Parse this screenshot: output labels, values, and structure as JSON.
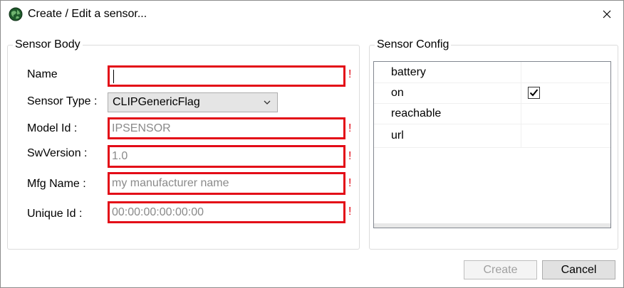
{
  "window": {
    "title": "Create / Edit a sensor..."
  },
  "sensor_body": {
    "legend": "Sensor Body",
    "fields": {
      "name": {
        "label": "Name",
        "value": "",
        "placeholder": ""
      },
      "sensor_type": {
        "label": "Sensor Type :",
        "selected": "CLIPGenericFlag"
      },
      "model_id": {
        "label": "Model Id :",
        "placeholder": "IPSENSOR"
      },
      "sw_version": {
        "label": "SwVersion :",
        "placeholder": "1.0"
      },
      "mfg_name": {
        "label": "Mfg Name :",
        "placeholder": "my manufacturer name"
      },
      "unique_id": {
        "label": "Unique Id :",
        "placeholder": "00:00:00:00:00:00"
      }
    },
    "required_marker": "!"
  },
  "sensor_config": {
    "legend": "Sensor Config",
    "rows": [
      {
        "name": "battery",
        "checked": false
      },
      {
        "name": "on",
        "checked": true
      },
      {
        "name": "reachable",
        "checked": false
      },
      {
        "name": "url",
        "checked": false
      }
    ]
  },
  "buttons": {
    "create_label": "Create",
    "cancel_label": "Cancel"
  },
  "icons": {
    "app": "globe-icon",
    "close": "close-icon",
    "dropdown": "chevron-down-icon",
    "check": "checkmark-icon"
  },
  "colors": {
    "required_border": "#e30b17",
    "placeholder_text": "#8a8a8a"
  }
}
